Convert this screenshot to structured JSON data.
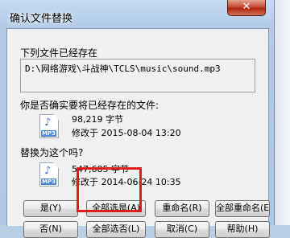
{
  "window": {
    "title": "确认文件替换",
    "close_glyph": "✕"
  },
  "dialog": {
    "exists_label": "下列文件已经存在",
    "path": "D:\\网络游戏\\斗战神\\TCLS\\music\\sound.mp3",
    "replace_question": "你是否确实要将已经存在的文件:",
    "existing_file": {
      "size": "98,219 字节",
      "modified": "修改于 2015-08-04 13:20",
      "icon": "mp3-file-icon"
    },
    "replace_with_label": "替换为这个吗?",
    "new_file": {
      "size": "547,685 字节",
      "modified": "修改于 2014-06-24 10:35",
      "icon": "mp3-file-icon"
    }
  },
  "buttons": {
    "yes": "是(Y)",
    "yes_to_all": "全部选是(A)",
    "rename": "重命名(R)",
    "rename_all": "全部重命名(E)",
    "no": "否(N)",
    "no_to_all": "全部选否(L)",
    "cancel": "取消(C)",
    "help": "帮助(H)"
  },
  "colors": {
    "highlight": "#d81e1e",
    "close_button": "#c74a34",
    "frame": "#b3cbe6"
  }
}
